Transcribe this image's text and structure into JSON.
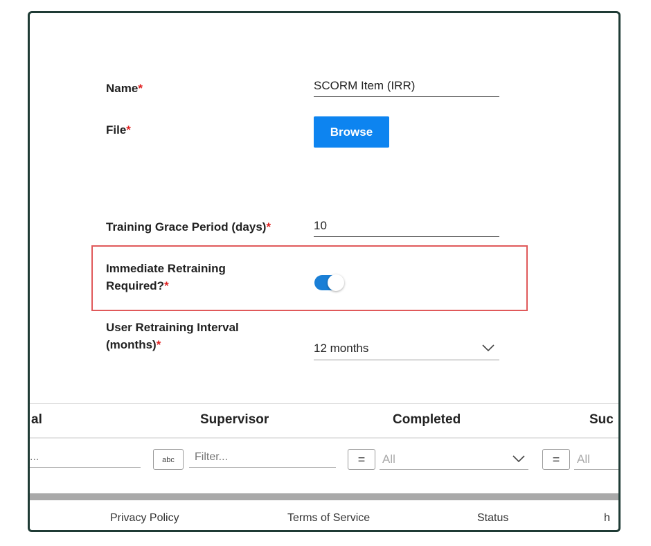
{
  "form": {
    "name_label": "Name",
    "name_value": "SCORM Item (IRR)",
    "file_label": "File",
    "browse_label": "Browse",
    "grace_label": "Training Grace Period (days)",
    "grace_value": "10",
    "retrain_label_line1": "Immediate Retraining",
    "retrain_label_line2": "Required?",
    "retrain_toggle_on": true,
    "interval_label_line1": "User Retraining Interval",
    "interval_label_line2": "(months)",
    "interval_value": "12 months",
    "required_mark": "*"
  },
  "grid": {
    "col_partial_left": "al",
    "col_supervisor": "Supervisor",
    "col_completed": "Completed",
    "col_partial_right": "Suc",
    "filter_partial_left": "...",
    "text_filter_icon": "abc",
    "filter_placeholder": "Filter...",
    "eq_symbol": "=",
    "all_placeholder": "All"
  },
  "footer": {
    "privacy": "Privacy Policy",
    "terms": "Terms of Service",
    "status": "Status",
    "partial": "h"
  },
  "colors": {
    "accent": "#0d84f0",
    "toggle": "#1a7fd6",
    "required": "#e02020",
    "highlight": "#e0595a",
    "frame": "#1f3b35"
  }
}
